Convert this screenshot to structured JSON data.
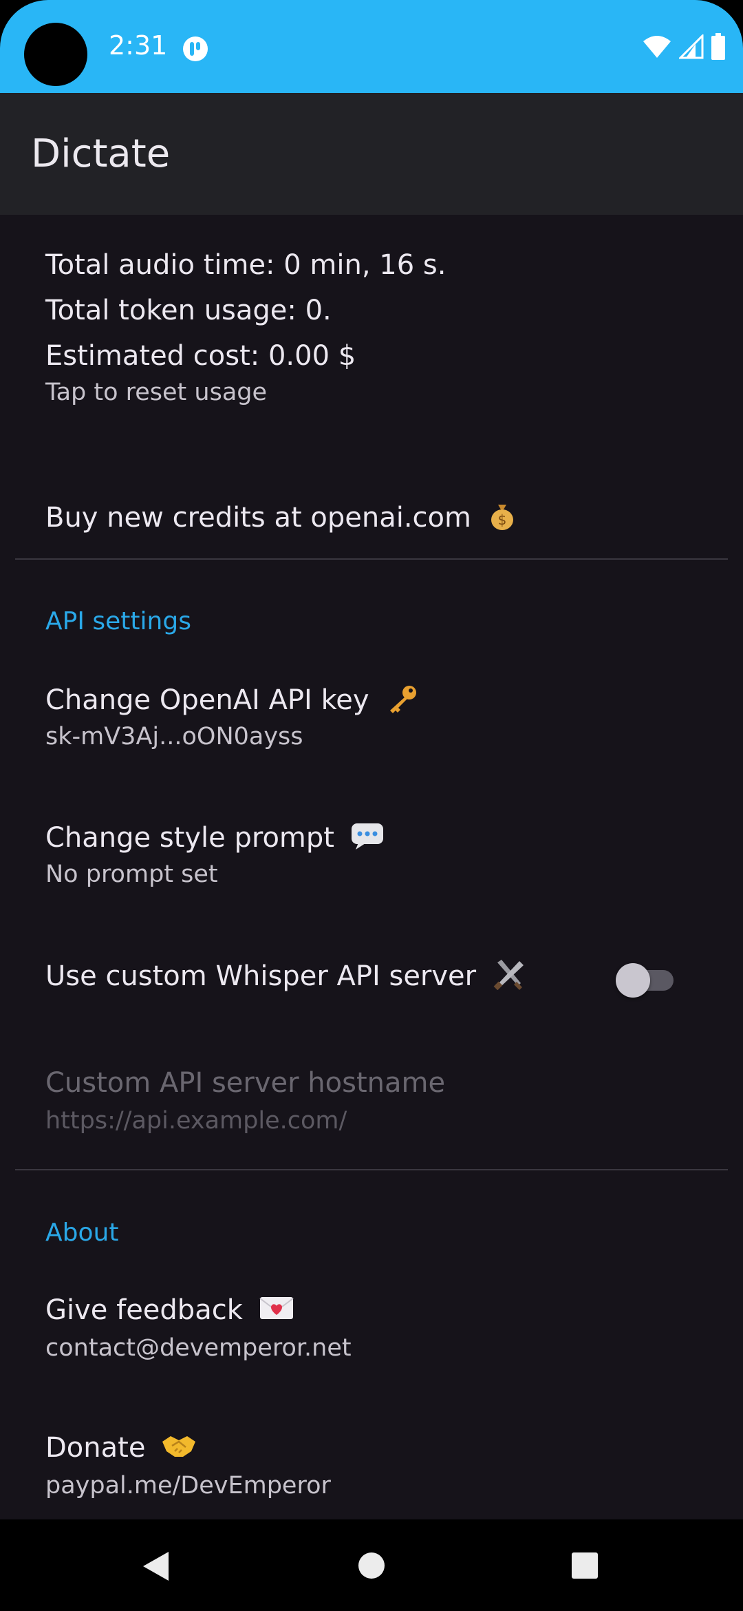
{
  "status_bar": {
    "time": "2:31",
    "icons": [
      "app-notification-icon",
      "wifi-icon",
      "signal-icon",
      "battery-icon"
    ],
    "color": "#29b6f6"
  },
  "app_bar": {
    "title": "Dictate"
  },
  "usage": {
    "audio_time": "Total audio time: 0 min, 16 s.",
    "token_usage": "Total token usage: 0.",
    "estimated_cost": "Estimated cost: 0.00 $",
    "reset_hint": "Tap to reset usage",
    "buy_credits": "Buy new credits at openai.com"
  },
  "api_settings": {
    "header": "API settings",
    "api_key": {
      "title": "Change OpenAI API key",
      "summary": "sk-mV3Aj...oON0ayss"
    },
    "style_prompt": {
      "title": "Change style prompt",
      "summary": "No prompt set"
    },
    "custom_server": {
      "title": "Use custom Whisper API server",
      "enabled": false
    },
    "hostname": {
      "title": "Custom API server hostname",
      "summary": "https://api.example.com/"
    }
  },
  "about": {
    "header": "About",
    "feedback": {
      "title": "Give feedback",
      "summary": "contact@devemperor.net"
    },
    "donate": {
      "title": "Donate",
      "summary": "paypal.me/DevEmperor"
    }
  },
  "colors": {
    "accent": "#2aa8e8",
    "background": "#16131a",
    "appbar": "#222226"
  }
}
